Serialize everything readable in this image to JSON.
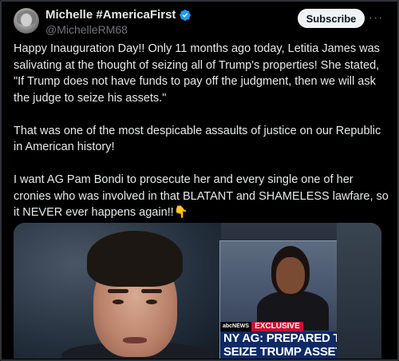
{
  "author": {
    "display_name": "Michelle #AmericaFirst",
    "handle": "@MichelleRM68",
    "verified_icon": "verified-badge-icon",
    "accent": "#1d9bf0"
  },
  "actions": {
    "subscribe_label": "Subscribe",
    "more_icon": "more-options-icon",
    "more_glyph": "···"
  },
  "post": {
    "text": "Happy Inauguration Day!! Only 11 months ago today, Letitia James was salivating at the thought of seizing all of Trump's properties! She stated, \"If Trump does not have funds to pay off the judgment, then we will ask the judge to seize his assets.\"\n\nThat was one of the most despicable assaults of justice on our Republic in American history!\n\nI want AG Pam Bondi to prosecute her and every single one of her cronies who was involved in that BLATANT and SHAMELESS lawfare, so it NEVER ever happens again!!👇"
  },
  "media": {
    "network_logo": "abcNEWS",
    "exclusive_label": "EXCLUSIVE",
    "chyron_line1": "NY AG: PREPARED TO",
    "chyron_line2": "SEIZE TRUMP ASSETS",
    "chyron_color": "#0c2a66",
    "exclusive_color": "#c8102e"
  }
}
